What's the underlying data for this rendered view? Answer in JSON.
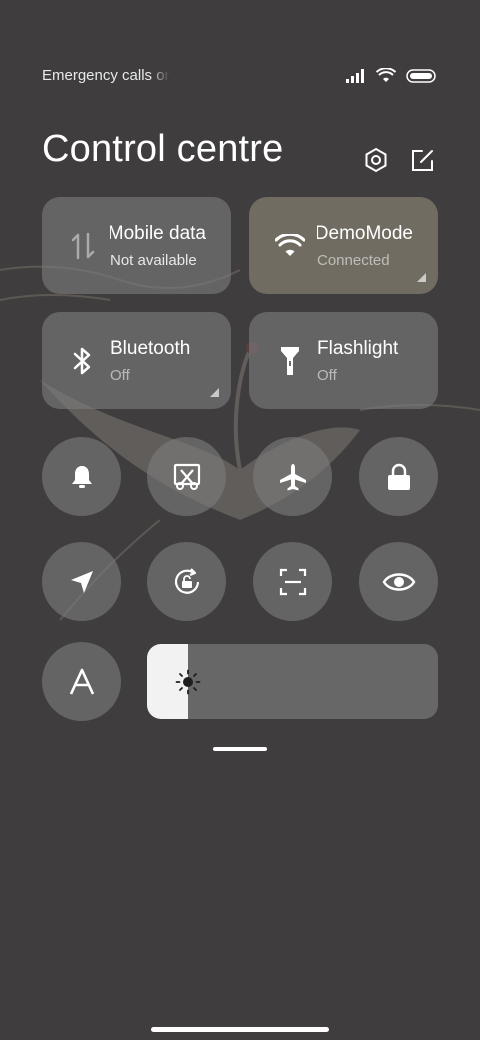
{
  "status_bar": {
    "carrier_text": "Emergency calls only",
    "signal_icon": "signal-icon",
    "wifi_icon": "wifi-icon",
    "battery_icon": "battery-icon"
  },
  "header": {
    "title": "Control centre",
    "settings_icon": "settings-icon",
    "edit_icon": "edit-icon"
  },
  "tiles": [
    {
      "label": "Mobile data",
      "status": "Not available",
      "icon": "mobile-data-icon",
      "active": false
    },
    {
      "label": "DemoMode",
      "status": "Connected",
      "icon": "wifi-icon",
      "active": true
    },
    {
      "label": "Bluetooth",
      "status": "Off",
      "icon": "bluetooth-icon",
      "active": false
    },
    {
      "label": "Flashlight",
      "status": "Off",
      "icon": "flashlight-icon",
      "active": false
    }
  ],
  "toggles": [
    {
      "icon": "bell-icon"
    },
    {
      "icon": "screenshot-icon"
    },
    {
      "icon": "airplane-icon"
    },
    {
      "icon": "lock-icon"
    },
    {
      "icon": "location-icon"
    },
    {
      "icon": "rotation-lock-icon"
    },
    {
      "icon": "scan-icon"
    },
    {
      "icon": "eye-icon"
    },
    {
      "icon": "font-icon"
    }
  ],
  "brightness": {
    "icon": "sun-icon",
    "level": 0.14
  },
  "colors": {
    "background": "#3f3d3e",
    "tile": "#7d7c7c",
    "active_tile": "#716c62",
    "slider_track": "#676767",
    "slider_fill": "#f2f2f2"
  }
}
